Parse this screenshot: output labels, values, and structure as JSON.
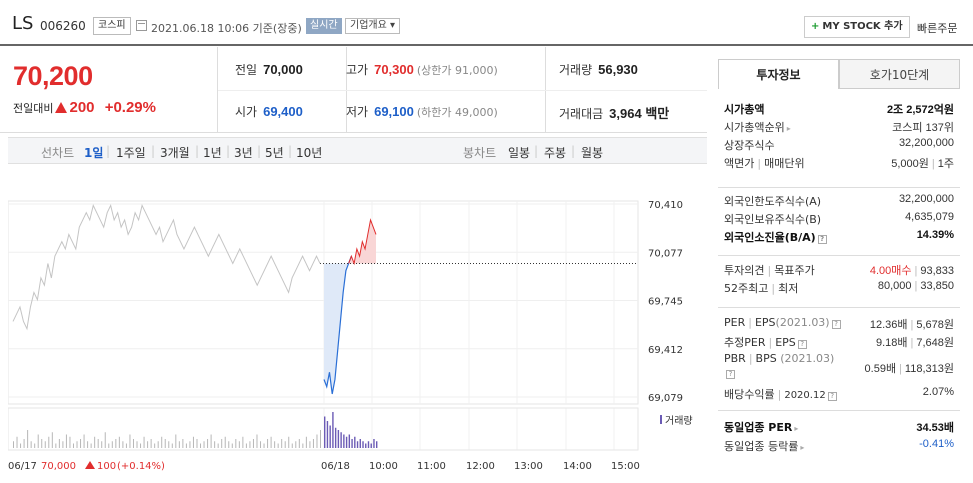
{
  "header": {
    "name": "LS",
    "code": "006260",
    "market": "코스피",
    "basis": "2021.06.18 10:06 기준(장중)",
    "realtime": "실시간",
    "company_info": "기업개요",
    "mystock": "MY STOCK 추가",
    "quick_order": "빠른주문"
  },
  "quote": {
    "price": "70,200",
    "change_label": "전일대비",
    "change": "200",
    "change_pct": "+0.29%",
    "prev_close_label": "전일",
    "prev_close": "70,000",
    "open_label": "시가",
    "open": "69,400",
    "high_label": "고가",
    "high": "70,300",
    "upper_limit": "(상한가 91,000)",
    "low_label": "저가",
    "low": "69,100",
    "lower_limit": "(하한가 49,000)",
    "volume_label": "거래량",
    "volume": "56,930",
    "amount_label": "거래대금",
    "amount": "3,964 백만"
  },
  "period_tabs": {
    "line_label": "선차트",
    "line": [
      "1일",
      "1주일",
      "3개월",
      "1년",
      "3년",
      "5년",
      "10년"
    ],
    "active": "1일",
    "candle_label": "봉차트",
    "candle": [
      "일봉",
      "주봉",
      "월봉"
    ]
  },
  "chart_data": {
    "type": "line",
    "y_ticks": [
      "70,410",
      "70,077",
      "69,745",
      "69,412",
      "69,079"
    ],
    "ylim": [
      69079,
      70410
    ],
    "prev_close": 70000,
    "x_ticks": [
      "06/17",
      "06/18",
      "10:00",
      "11:00",
      "12:00",
      "13:00",
      "14:00",
      "15:00"
    ],
    "prev_day_label": "06/17",
    "prev_day_close": "70,000",
    "prev_day_change": "100",
    "prev_day_pct": "(+0.14%)",
    "volume_label": "거래량",
    "prev_day_series": [
      69600,
      69650,
      69700,
      69600,
      69550,
      69700,
      69800,
      69750,
      69900,
      69850,
      70000,
      69900,
      70050,
      70100,
      70150,
      70100,
      70200,
      70150,
      70100,
      70250,
      70300,
      70350,
      70300,
      70400,
      70350,
      70300,
      70250,
      70350,
      70400,
      70300,
      70350,
      70250,
      70300,
      70200,
      70250,
      70350,
      70300,
      70400,
      70350,
      70300,
      70250,
      70200,
      70250,
      70150,
      70200,
      70250,
      70300,
      70200,
      70150,
      70100,
      70150,
      70200,
      70250,
      70200,
      70150,
      70100,
      70050,
      70100,
      70150,
      70200,
      70150,
      70100,
      70050,
      70000,
      70050,
      70100,
      70050,
      70000,
      69950,
      69900,
      69850,
      69900,
      69950,
      70000,
      70050,
      70000,
      69950,
      69900,
      69850,
      69800,
      69900,
      69950,
      70000,
      70050,
      70000,
      69950,
      70000,
      70050,
      70000
    ],
    "today_series": [
      69200,
      69150,
      69250,
      69100,
      69200,
      69400,
      69600,
      69800,
      69950,
      70000,
      70050,
      70000,
      70100,
      70050,
      70150,
      70100,
      70200,
      70300,
      70250,
      70200
    ],
    "prev_day_volume": [
      3,
      5,
      2,
      4,
      8,
      3,
      2,
      6,
      4,
      3,
      5,
      7,
      2,
      4,
      3,
      6,
      5,
      2,
      3,
      4,
      6,
      3,
      2,
      5,
      4,
      3,
      7,
      2,
      3,
      4,
      5,
      3,
      2,
      6,
      4,
      3,
      2,
      5,
      3,
      4,
      2,
      3,
      5,
      4,
      3,
      2,
      6,
      3,
      4,
      2,
      3,
      5,
      4,
      2,
      3,
      4,
      6,
      3,
      2,
      4,
      5,
      3,
      2,
      4,
      3,
      5,
      2,
      3,
      4,
      6,
      3,
      2,
      4,
      5,
      3,
      2,
      4,
      3,
      5,
      2,
      3,
      4,
      2,
      5,
      3,
      4,
      6,
      8
    ],
    "today_volume": [
      14,
      12,
      10,
      16,
      9,
      8,
      7,
      6,
      5,
      6,
      4,
      5,
      3,
      4,
      3,
      2,
      3,
      2,
      4,
      3
    ]
  },
  "side_panel": {
    "tab_invest": "투자정보",
    "tab_hoga": "호가10단계",
    "market_cap_label": "시가총액",
    "market_cap": "2조 2,572억원",
    "market_cap_rank_label": "시가총액순위",
    "market_cap_rank": "코스피 137위",
    "shares_label": "상장주식수",
    "shares": "32,200,000",
    "par_label": "액면가",
    "unit_label": "매매단위",
    "par": "5,000원",
    "unit": "1주",
    "foreign_limit_label": "외국인한도주식수(A)",
    "foreign_limit": "32,200,000",
    "foreign_hold_label": "외국인보유주식수(B)",
    "foreign_hold": "4,635,079",
    "foreign_ratio_label": "외국인소진율(B/A)",
    "foreign_ratio": "14.39%",
    "opinion_label": "투자의견",
    "target_label": "목표주가",
    "opinion": "4.00매수",
    "target": "93,833",
    "high52_label": "52주최고",
    "low52_label": "최저",
    "high52": "80,000",
    "low52": "33,850",
    "per_label": "PER",
    "eps_label": "EPS",
    "per_eps_date": "(2021.03)",
    "per": "12.36배",
    "eps": "5,678원",
    "fper_label": "추정PER",
    "feps_label": "EPS",
    "fper": "9.18배",
    "feps": "7,648원",
    "pbr_label": "PBR",
    "bps_label": "BPS",
    "pbr_date": "(2021.03)",
    "pbr": "0.59배",
    "bps": "118,313원",
    "div_label": "배당수익률",
    "div_date": "2020.12",
    "div": "2.07%",
    "ind_per_label": "동일업종 PER",
    "ind_per": "34.53배",
    "ind_change_label": "동일업종 등락률",
    "ind_change": "-0.41%"
  }
}
